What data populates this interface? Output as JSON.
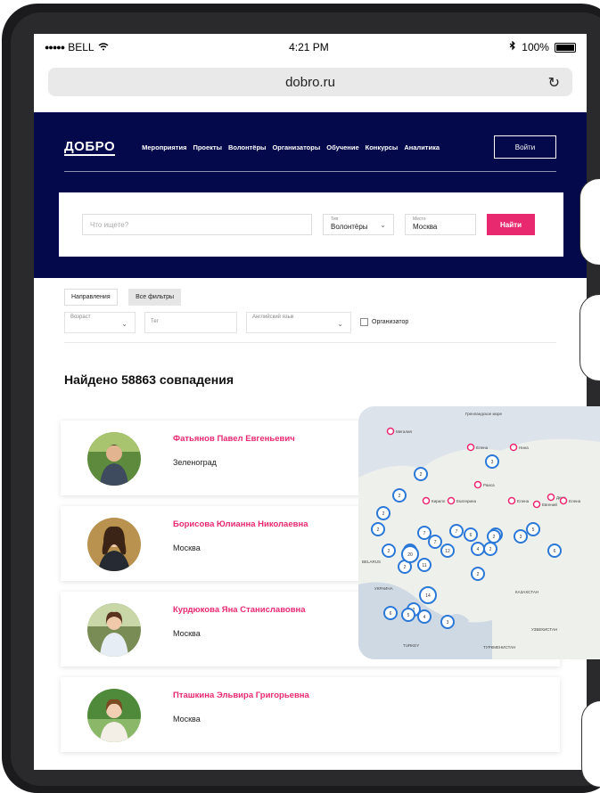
{
  "status": {
    "carrier": "BELL",
    "time": "4:21 PM",
    "battery": "100%"
  },
  "browser": {
    "url": "dobro.ru"
  },
  "header": {
    "logo": "ДОБРО",
    "nav": [
      "Мероприятия",
      "Проекты",
      "Волонтёры",
      "Организаторы",
      "Обучение",
      "Конкурсы",
      "Аналитика"
    ],
    "login": "Войти"
  },
  "search": {
    "placeholder": "Что ищете?",
    "type_label": "Тип",
    "type_value": "Волонтёры",
    "place_label": "Место",
    "place_value": "Москва",
    "submit": "Найти"
  },
  "filters": {
    "directions": "Направления",
    "all_filters": "Все фильтры",
    "age_label": "Возраст",
    "tag_placeholder": "Тег",
    "language_label": "Английский язык",
    "organizer": "Организатор"
  },
  "results": {
    "title": "Найдено 58863 совпадения",
    "items": [
      {
        "name": "Фатьянов Павел Евгеньевич",
        "city": "Зеленоград"
      },
      {
        "name": "Борисова Юлианна Николаевна",
        "city": "Москва"
      },
      {
        "name": "Курдюкова Яна Станиславовна",
        "city": "Москва"
      },
      {
        "name": "Пташкина Эльвира Григорьевна",
        "city": "Москва"
      }
    ]
  },
  "map": {
    "labels": [
      "Гренландское море",
      "Мегалия",
      "Елена",
      "Нина",
      "Раиса",
      "Кирилл",
      "Екатерина",
      "Елена",
      "Евгений",
      "Дени",
      "Елена",
      "BELARUS",
      "УКРАИНА",
      "КАЗАХСТАН",
      "УЗБЕКИСТАН",
      "ТУРКМЕНИСТАН",
      "TURKEY"
    ],
    "clusters": [
      "2",
      "2",
      "2",
      "7",
      "2",
      "3",
      "7",
      "2",
      "2",
      "2",
      "7",
      "20",
      "11",
      "12",
      "6",
      "2",
      "3",
      "5",
      "4",
      "2",
      "2",
      "6",
      "14",
      "2",
      "6",
      "5",
      "4",
      "3",
      "2"
    ]
  },
  "colors": {
    "navy": "#03094a",
    "accent": "#e8296f",
    "cluster": "#2b78d6"
  }
}
